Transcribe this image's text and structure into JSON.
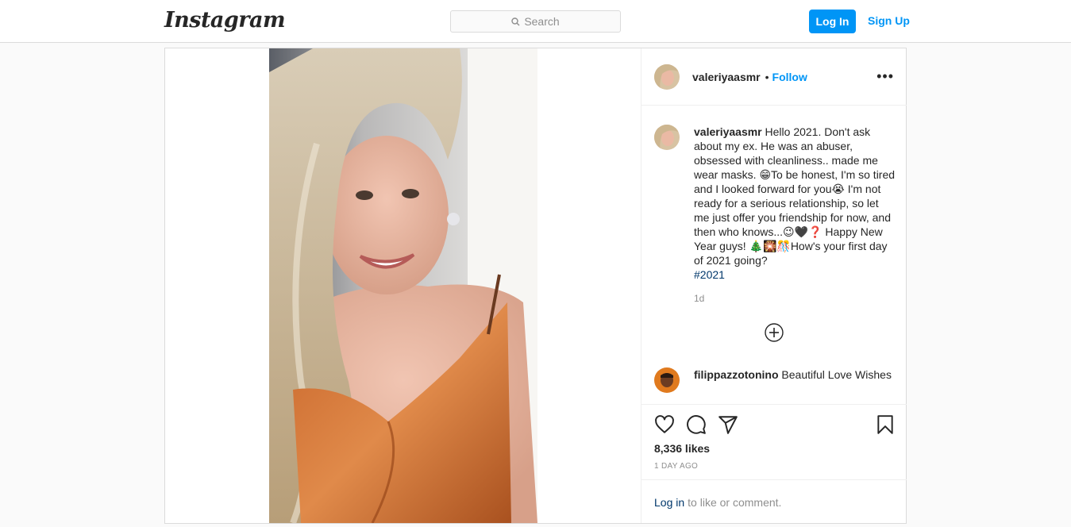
{
  "nav": {
    "logo": "Instagram",
    "search_placeholder": "Search",
    "login_label": "Log In",
    "signup_label": "Sign Up"
  },
  "post": {
    "username": "valeriyaasmr",
    "follow_separator": "•",
    "follow_label": "Follow",
    "more_label": "•••",
    "caption": "Hello 2021. Don't ask about my ex. He was an abuser, obsessed with cleanliness.. made me wear masks. 😁To be honest, I'm so tired and I looked forward for you😭 I'm not ready for a serious relationship, so let me just offer you friendship for now, and then who knows...😉🖤❓ Happy New Year guys! 🎄🎇🎊How's your first day of 2021 going?",
    "hashtag": "#2021",
    "caption_time": "1d",
    "comments": [
      {
        "username": "filippazzotonino",
        "text": "Beautiful Love Wishes"
      }
    ],
    "likes": "8,336 likes",
    "date": "1 DAY AGO",
    "login_link": "Log in",
    "login_prompt": "to like or comment."
  },
  "icons": {
    "search": "search-icon",
    "more": "more-options-icon",
    "load_more": "plus-circle-icon",
    "like": "heart-icon",
    "comment": "comment-bubble-icon",
    "share": "paper-plane-icon",
    "save": "bookmark-icon"
  },
  "colors": {
    "accent": "#0095f6",
    "hashtag": "#00376b",
    "secondary_text": "#8e8e8e",
    "border": "#dbdbdb"
  }
}
